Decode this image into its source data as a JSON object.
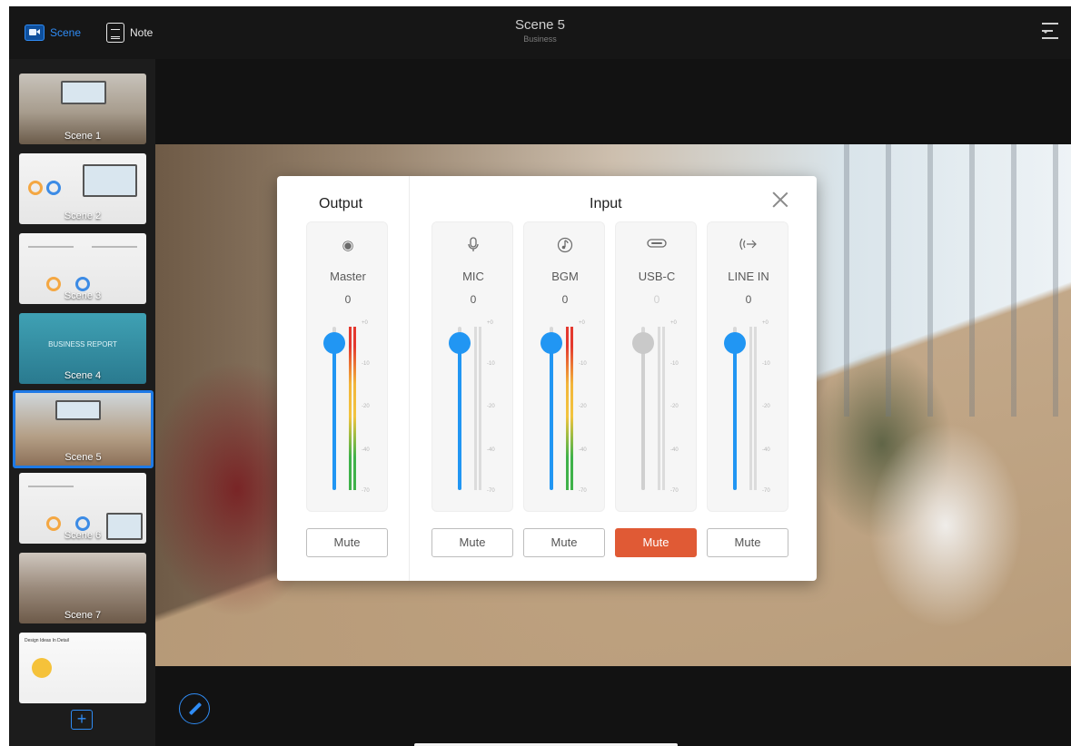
{
  "topbar": {
    "scene_tab": "Scene",
    "note_tab": "Note",
    "title": "Scene 5",
    "subtitle": "Business"
  },
  "sidebar": {
    "scenes": [
      {
        "label": "Scene 1",
        "style": "office"
      },
      {
        "label": "Scene 2",
        "style": "slide"
      },
      {
        "label": "Scene 3",
        "style": "slide"
      },
      {
        "label": "Scene 4",
        "style": "blue",
        "slide_title": "BUSINESS REPORT"
      },
      {
        "label": "Scene 5",
        "style": "meeting",
        "selected": true
      },
      {
        "label": "Scene 6",
        "style": "slide"
      },
      {
        "label": "Scene 7",
        "style": "people"
      },
      {
        "label": "",
        "style": "idea",
        "slide_title": "Design Ideas In Detail"
      }
    ],
    "add_label": "+"
  },
  "mixer": {
    "output_title": "Output",
    "input_title": "Input",
    "mute_label": "Mute",
    "scale_ticks": [
      "+0",
      "-10",
      "-20",
      "-40",
      "-70"
    ],
    "channels": [
      {
        "name": "Master",
        "icon": "record-icon",
        "glyph": "◉",
        "value": "0",
        "level": 0.9,
        "muted": false,
        "enabled": true,
        "meter": true
      },
      {
        "name": "MIC",
        "icon": "microphone-icon",
        "glyph": "🎙",
        "value": "0",
        "level": 0.9,
        "muted": false,
        "enabled": true,
        "meter": false
      },
      {
        "name": "BGM",
        "icon": "music-note-icon",
        "glyph": "♪",
        "value": "0",
        "level": 0.9,
        "muted": false,
        "enabled": true,
        "meter": true
      },
      {
        "name": "USB-C",
        "icon": "usb-c-icon",
        "glyph": "▭",
        "value": "0",
        "level": 0.9,
        "muted": true,
        "enabled": false,
        "meter": false
      },
      {
        "name": "LINE IN",
        "icon": "line-in-icon",
        "glyph": "((·))",
        "value": "0",
        "level": 0.9,
        "muted": false,
        "enabled": true,
        "meter": false
      }
    ]
  },
  "colors": {
    "accent": "#2196f3",
    "mute_active": "#e05a35"
  }
}
